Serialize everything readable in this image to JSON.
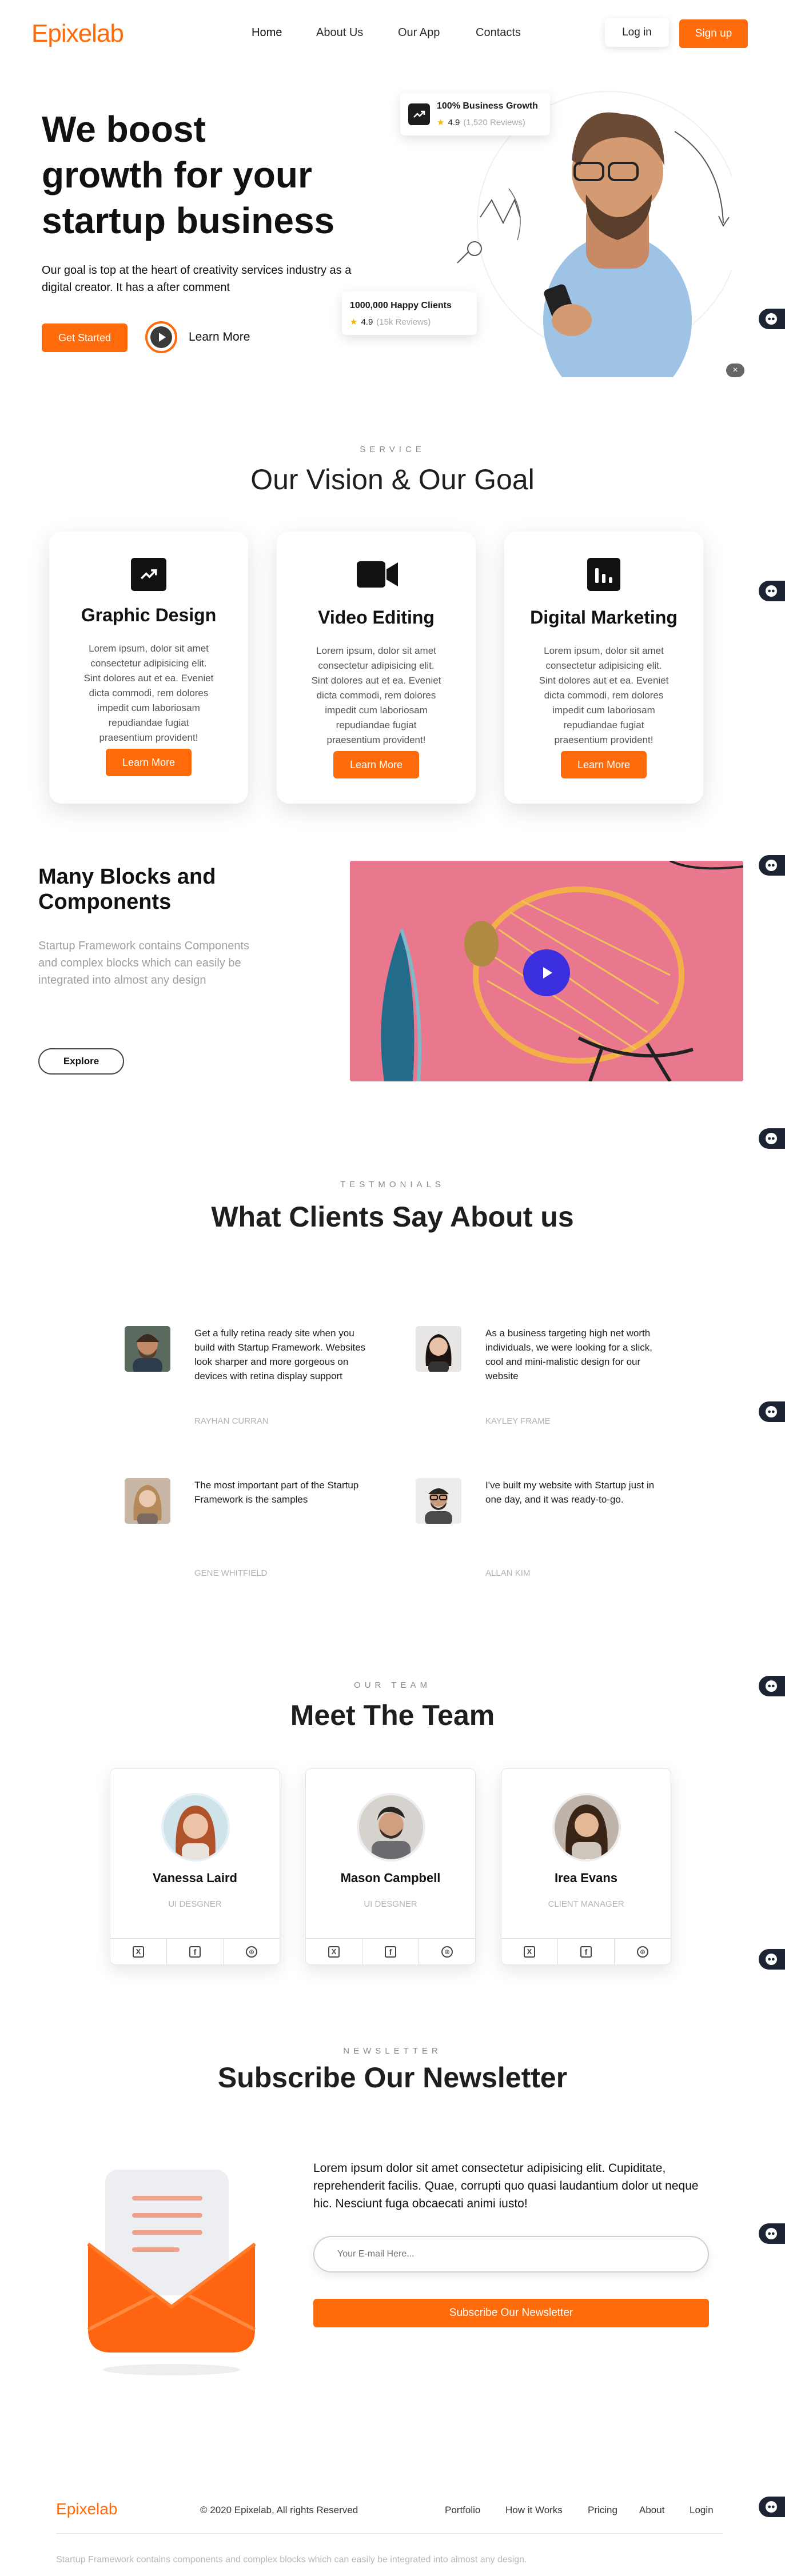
{
  "brand": {
    "logo_prefix": "E",
    "logo_text": "pixelab",
    "accent": "#ff6b0b"
  },
  "nav": {
    "items": [
      "Home",
      "About Us",
      "Our App",
      "Contacts"
    ],
    "login": "Log in",
    "signup": "Sign up"
  },
  "hero": {
    "title_lines": [
      "We boost",
      "growth for your",
      "startup business"
    ],
    "subtitle": "Our goal is top at the heart of creativity services industry as a digital creator. It has a after comment",
    "cta": "Get Started",
    "learn_more": "Learn More",
    "badge1": {
      "title": "100% Business Growth",
      "rating": "4.9",
      "reviews": "(1,520 Reviews)"
    },
    "badge2": {
      "title": "1000,000 Happy Clients",
      "rating": "4.9",
      "reviews": "(15k Reviews)"
    },
    "close": "×"
  },
  "service": {
    "eyebrow": "SERVICE",
    "title": "Our Vision & Our Goal",
    "cards": [
      {
        "icon": "trending-up-icon",
        "title": "Graphic Design",
        "text": "Lorem ipsum, dolor sit amet consectetur adipisicing elit. Sint dolores aut et ea. Eveniet dicta commodi, rem dolores impedit cum laboriosam repudiandae fugiat praesentium provident!",
        "button": "Learn More"
      },
      {
        "icon": "video-camera-icon",
        "title": "Video Editing",
        "text": "Lorem ipsum, dolor sit amet consectetur adipisicing elit. Sint dolores aut et ea. Eveniet dicta commodi, rem dolores impedit cum laboriosam repudiandae fugiat praesentium provident!",
        "button": "Learn More"
      },
      {
        "icon": "bar-chart-icon",
        "title": "Digital Marketing",
        "text": "Lorem ipsum, dolor sit amet consectetur adipisicing elit. Sint dolores aut et ea. Eveniet dicta commodi, rem dolores impedit cum laboriosam repudiandae fugiat praesentium provident!",
        "button": "Learn More"
      }
    ]
  },
  "blocks": {
    "title": "Many Blocks and Components",
    "text": "Startup Framework contains Components and complex blocks which can easily be integrated into almost any design",
    "button": "Explore"
  },
  "testimonials": {
    "eyebrow": "TESTMONIALS",
    "title": "What Clients Say About us",
    "items": [
      {
        "text": "Get a fully retina ready site when you build with Startup Framework. Websites look sharper and more gorgeous on devices with retina display support",
        "name": "RAYHAN CURRAN"
      },
      {
        "text": "As a business targeting high net worth individuals, we were looking for a slick, cool and mini-malistic design for our website",
        "name": "KAYLEY FRAME"
      },
      {
        "text": "The most important part of the Startup Framework is the samples",
        "name": "GENE WHITFIELD"
      },
      {
        "text": "I've built my website with Startup just in one day, and it was ready-to-go.",
        "name": "ALLAN KIM"
      }
    ]
  },
  "team": {
    "eyebrow": "OUR TEAM",
    "title": "Meet The Team",
    "members": [
      {
        "name": "Vanessa Laird",
        "role": "UI DESGNER"
      },
      {
        "name": "Mason Campbell",
        "role": "UI DESGNER"
      },
      {
        "name": "Irea Evans",
        "role": "CLIENT MANAGER"
      }
    ],
    "social_icons": [
      "x-icon",
      "facebook-icon",
      "dribbble-icon"
    ]
  },
  "newsletter": {
    "eyebrow": "NEWSLETTER",
    "title": "Subscribe Our Newsletter",
    "text": "Lorem ipsum dolor sit amet consectetur adipisicing elit. Cupiditate, reprehenderit facilis. Quae, corrupti quo quasi laudantium dolor ut neque hic. Nesciunt fuga obcaecati animi iusto!",
    "placeholder": "Your E-mail Here...",
    "button": "Subscribe Our Newsletter"
  },
  "footer": {
    "copyright": "© 2020 Epixelab, All rights Reserved",
    "links": [
      "Portfolio",
      "How it Works",
      "Pricing",
      "About",
      "Login"
    ],
    "tagline": "Startup Framework contains components and complex blocks which can easily be integrated into almost any design."
  }
}
